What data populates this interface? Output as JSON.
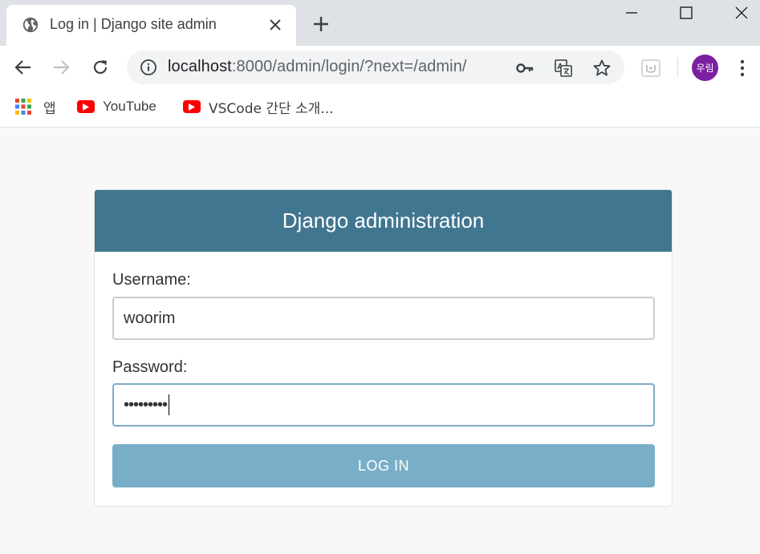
{
  "browser": {
    "tab": {
      "title": "Log in | Django site admin",
      "favicon": "globe-icon"
    },
    "window_controls": [
      "minimize-icon",
      "maximize-icon",
      "close-icon"
    ],
    "omnibox": {
      "host": "localhost",
      "path": ":8000/admin/login/?next=/admin/"
    },
    "profile": {
      "avatar_label": "우림",
      "avatar_color": "#7b1fa2"
    },
    "bookmarks": [
      {
        "label": "앱",
        "icon": "apps-grid-icon"
      },
      {
        "label": "YouTube",
        "icon": "youtube-icon"
      },
      {
        "label": "VSCode 간단 소개...",
        "icon": "youtube-icon"
      }
    ]
  },
  "login": {
    "header_title": "Django administration",
    "username_label": "Username:",
    "username_value": "woorim",
    "password_label": "Password:",
    "password_value": "•••••••••",
    "submit_label": "LOG IN"
  },
  "colors": {
    "header_bg": "#417690",
    "button_bg": "#79aec8",
    "tabstrip_bg": "#dee1e6",
    "page_bg": "#f8f8f8"
  }
}
